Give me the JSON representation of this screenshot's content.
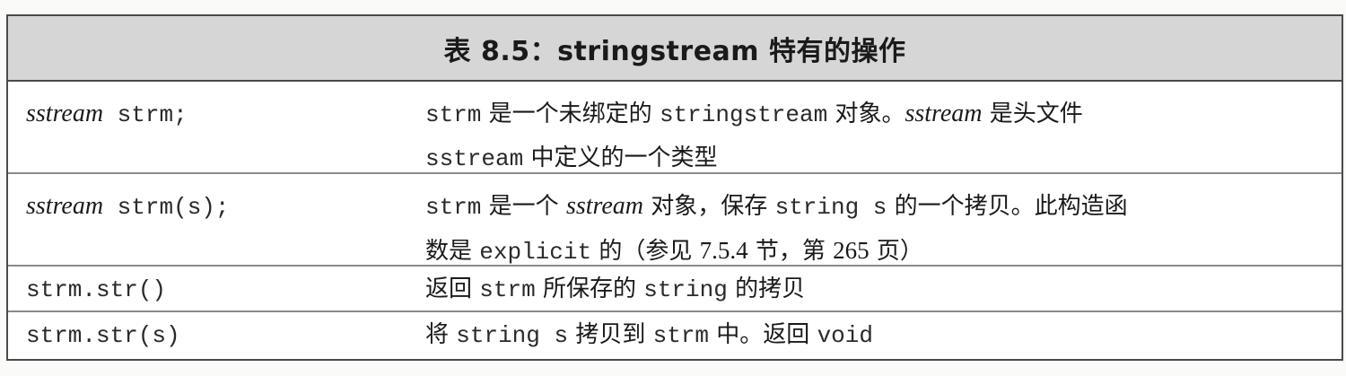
{
  "table": {
    "caption": "表 8.5：stringstream 特有的操作",
    "rows": [
      {
        "left": {
          "type_name": "sstream",
          "code": " strm;"
        },
        "right": {
          "line1": {
            "c1": "strm",
            "t1": " 是一个未绑定的 ",
            "c2": "stringstream",
            "t2": " 对象。",
            "i1": "sstream",
            "t3": " 是头文件"
          },
          "line2": {
            "c1": "sstream",
            "t1": " 中定义的一个类型"
          }
        }
      },
      {
        "left": {
          "type_name": "sstream",
          "code": " strm(s);"
        },
        "right": {
          "line1": {
            "c1": "strm",
            "t1": " 是一个 ",
            "i1": "sstream",
            "t2": " 对象，保存 ",
            "c2": "string s",
            "t3": " 的一个拷贝。此构造函"
          },
          "line2": {
            "t1": "数是 ",
            "c1": "explicit",
            "t2": " 的（参见 ",
            "n1": "7.5.4",
            "t3": " 节，第 ",
            "n2": "265",
            "t4": " 页）"
          }
        }
      },
      {
        "left": {
          "code": "strm.str()"
        },
        "right": {
          "line1": {
            "t1": "返回 ",
            "c1": "strm",
            "t2": " 所保存的 ",
            "c2": "string",
            "t3": " 的拷贝"
          }
        }
      },
      {
        "left": {
          "code": "strm.str(s)"
        },
        "right": {
          "line1": {
            "t1": "将 ",
            "c1": "string s",
            "t2": " 拷贝到 ",
            "c2": "strm",
            "t3": " 中。返回 ",
            "c3": "void"
          }
        }
      }
    ]
  }
}
